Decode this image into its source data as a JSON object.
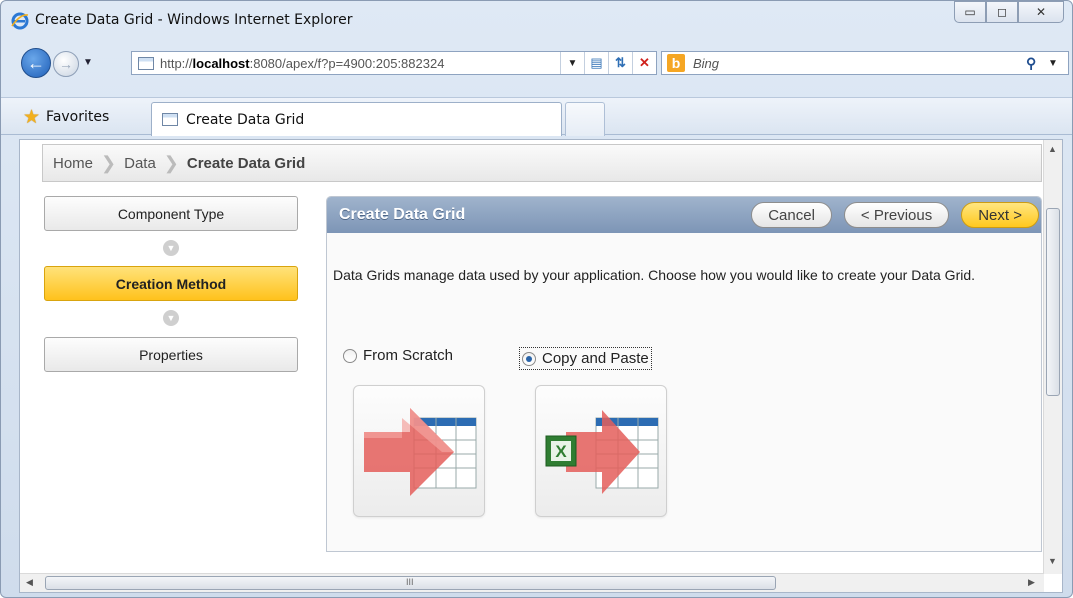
{
  "window": {
    "title": "Create Data Grid - Windows Internet Explorer",
    "minimize_glyph": "▭",
    "maximize_glyph": "◻",
    "close_glyph": "✕"
  },
  "address_bar": {
    "url_prefix": "http://",
    "url_host": "localhost",
    "url_rest": ":8080/apex/f?p=4900:205:882324"
  },
  "search": {
    "placeholder": "Bing"
  },
  "favorites": {
    "label": "Favorites"
  },
  "tab": {
    "label": "Create Data Grid"
  },
  "breadcrumb": [
    {
      "label": "Home"
    },
    {
      "label": "Data"
    },
    {
      "label": "Create Data Grid"
    }
  ],
  "wizard_steps": [
    {
      "label": "Component Type",
      "active": false
    },
    {
      "label": "Creation Method",
      "active": true
    },
    {
      "label": "Properties",
      "active": false
    }
  ],
  "region": {
    "title": "Create Data Grid",
    "cancel_label": "Cancel",
    "previous_label": "< Previous",
    "next_label": "Next >",
    "description": "Data Grids manage data used by your application. Choose how you would like to create your Data Grid."
  },
  "options": [
    {
      "label": "From Scratch",
      "selected": false
    },
    {
      "label": "Copy and Paste",
      "selected": true
    }
  ],
  "scrollbar": {
    "grip_glyph": "III"
  },
  "colors": {
    "accent_yellow": "#ffc21c",
    "region_header": "#8aa0be"
  }
}
